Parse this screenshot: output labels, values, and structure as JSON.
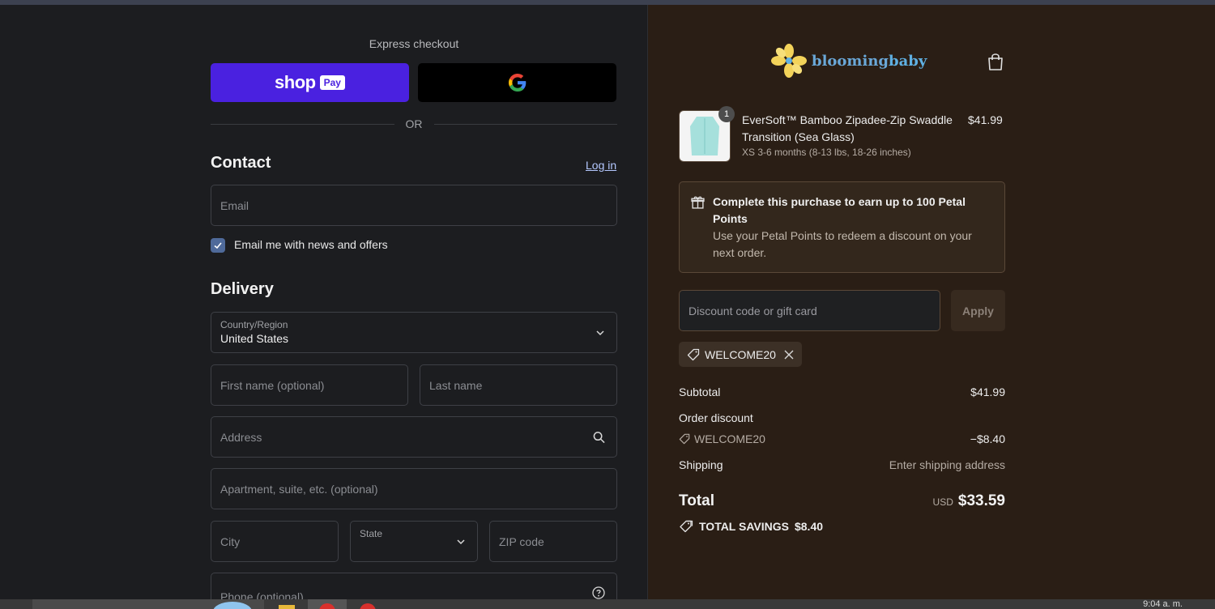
{
  "express": {
    "title": "Express checkout",
    "shop_pay_word": "shop",
    "shop_pay_badge": "Pay",
    "or_label": "OR"
  },
  "contact": {
    "heading": "Contact",
    "login_link": "Log in",
    "email_placeholder": "Email",
    "news_checkbox_label": "Email me with news and offers",
    "news_checked": true
  },
  "delivery": {
    "heading": "Delivery",
    "country_label": "Country/Region",
    "country_value": "United States",
    "first_name_placeholder": "First name (optional)",
    "last_name_placeholder": "Last name",
    "address_placeholder": "Address",
    "apartment_placeholder": "Apartment, suite, etc. (optional)",
    "city_placeholder": "City",
    "state_label": "State",
    "zip_placeholder": "ZIP code",
    "phone_placeholder": "Phone (optional)"
  },
  "brand": {
    "logo_part1": "blooming",
    "logo_part2": "baby"
  },
  "cart": {
    "item": {
      "quantity": "1",
      "name": "EverSoft™ Bamboo Zipadee-Zip Swaddle Transition (Sea Glass)",
      "variant": "XS 3-6 months (8-13 lbs, 18-26 inches)",
      "price": "$41.99"
    }
  },
  "points": {
    "title": "Complete this purchase to earn up to 100 Petal Points",
    "body": "Use your Petal Points to redeem a discount on your next order."
  },
  "discount": {
    "placeholder": "Discount code or gift card",
    "apply_label": "Apply",
    "applied_code": "WELCOME20"
  },
  "summary": {
    "subtotal_label": "Subtotal",
    "subtotal_value": "$41.99",
    "order_discount_label": "Order discount",
    "discount_code": "WELCOME20",
    "discount_value": "−$8.40",
    "shipping_label": "Shipping",
    "shipping_value": "Enter shipping address",
    "total_label": "Total",
    "currency": "USD",
    "total_value": "$33.59",
    "savings_label": "TOTAL SAVINGS",
    "savings_value": "$8.40"
  },
  "taskbar": {
    "clock": "9:04 a. m."
  },
  "colors": {
    "shop_pay": "#4a21e0",
    "left_bg": "#1c1d20",
    "right_bg": "#2a1e15",
    "link": "#b4c8ff"
  }
}
